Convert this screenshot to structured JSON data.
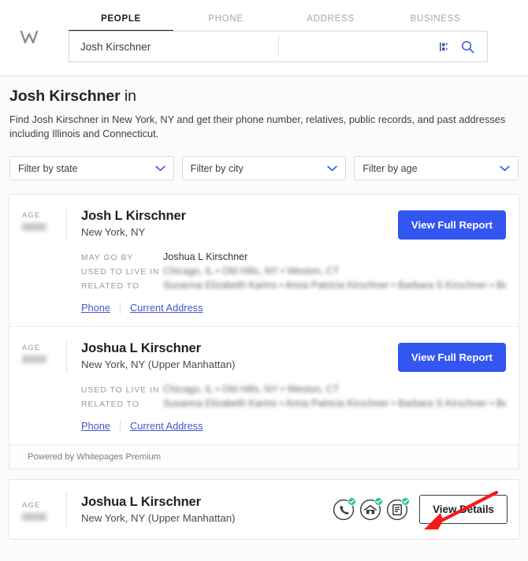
{
  "header": {
    "logo_text": "W",
    "tabs": [
      {
        "label": "PEOPLE",
        "active": true
      },
      {
        "label": "PHONE",
        "active": false
      },
      {
        "label": "ADDRESS",
        "active": false
      },
      {
        "label": "BUSINESS",
        "active": false
      }
    ],
    "search": {
      "value": "Josh Kirschner",
      "placeholder": "",
      "second_value": "",
      "second_placeholder": "",
      "filter_icon": "sliders-icon",
      "search_icon": "search-icon",
      "icon_color": "#2f4ba0",
      "search_icon_color": "#3b63d8"
    }
  },
  "title": {
    "name": "Josh Kirschner",
    "suffix": " in",
    "description": "Find Josh Kirschner in New York, NY and get their phone number, relatives, public records, and past addresses including Illinois and Connecticut."
  },
  "filters": [
    {
      "label": "Filter by state",
      "name": "filter-state"
    },
    {
      "label": "Filter by city",
      "name": "filter-city"
    },
    {
      "label": "Filter by age",
      "name": "filter-age"
    }
  ],
  "results": [
    {
      "age_label": "AGE",
      "age_value": "",
      "name": "Josh L Kirschner",
      "location": "New York, NY",
      "button_label": "View Full Report",
      "meta": [
        {
          "key": "MAY GO BY",
          "value": "Joshua L Kirschner",
          "blurred": false
        },
        {
          "key": "USED TO LIVE IN",
          "value": "Chicago, IL • Old Hills, NY • Weston, CT",
          "blurred": true
        },
        {
          "key": "RELATED TO",
          "value": "Susanna Elizabeth Karins • Anna Patricia Kirschner • Barbara S Kirschner • Benja…",
          "blurred": true
        }
      ],
      "links": [
        {
          "label": "Phone"
        },
        {
          "label": "Current Address"
        }
      ]
    },
    {
      "age_label": "AGE",
      "age_value": "",
      "name": "Joshua L Kirschner",
      "location": "New York, NY (Upper Manhattan)",
      "button_label": "View Full Report",
      "meta": [
        {
          "key": "USED TO LIVE IN",
          "value": "Chicago, IL • Old Hills, NY • Weston, CT",
          "blurred": true
        },
        {
          "key": "RELATED TO",
          "value": "Susanna Elizabeth Karins • Anna Patricia Kirschner • Barbara S Kirschner • Benja…",
          "blurred": true
        }
      ],
      "links": [
        {
          "label": "Phone"
        },
        {
          "label": "Current Address"
        }
      ]
    }
  ],
  "footer": {
    "powered_by": "Powered by Whitepages Premium"
  },
  "bottom_card": {
    "age_label": "AGE",
    "name": "Joshua L Kirschner",
    "location": "New York, NY (Upper Manhattan)",
    "verify_icons": [
      {
        "name": "phone-verified-icon"
      },
      {
        "name": "address-verified-icon"
      },
      {
        "name": "records-verified-icon"
      }
    ],
    "details_button": "View Details"
  },
  "annotation": {
    "arrow_color": "#f41a1a",
    "points_to": "View Details"
  }
}
